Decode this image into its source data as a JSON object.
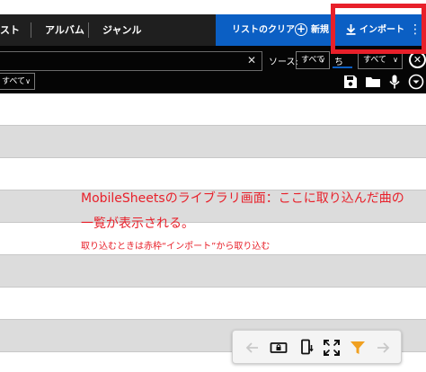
{
  "tabs": [
    {
      "label": "スト"
    },
    {
      "label": "アルバム"
    },
    {
      "label": "ジャンル"
    }
  ],
  "actions": {
    "clear_list": "リストのクリア",
    "new": "新規",
    "import": "インポート"
  },
  "filter": {
    "source_label": "ソース:",
    "source_value": "すべて",
    "sort_label": "ち",
    "sort_value": "すべて",
    "second_value": "すべて"
  },
  "annotation": {
    "line1": "MobileSheetsのライブラリ画面：ここに取り込んだ曲の",
    "line2": "一覧が表示される。",
    "line3": "取り込むときは赤枠“インポート”から取り込む"
  },
  "colors": {
    "accent_blue": "#0b5fc4",
    "highlight_red": "#e8202a",
    "filter_orange": "#f0a020"
  },
  "icons": {
    "toolbar": [
      "save-icon",
      "folder-icon",
      "microphone-icon",
      "chevron-down-circle-icon"
    ],
    "bottom": [
      "arrow-left-icon",
      "lock-screen-icon",
      "phone-rotate-icon",
      "fullscreen-icon",
      "filter-icon",
      "arrow-right-icon"
    ]
  }
}
